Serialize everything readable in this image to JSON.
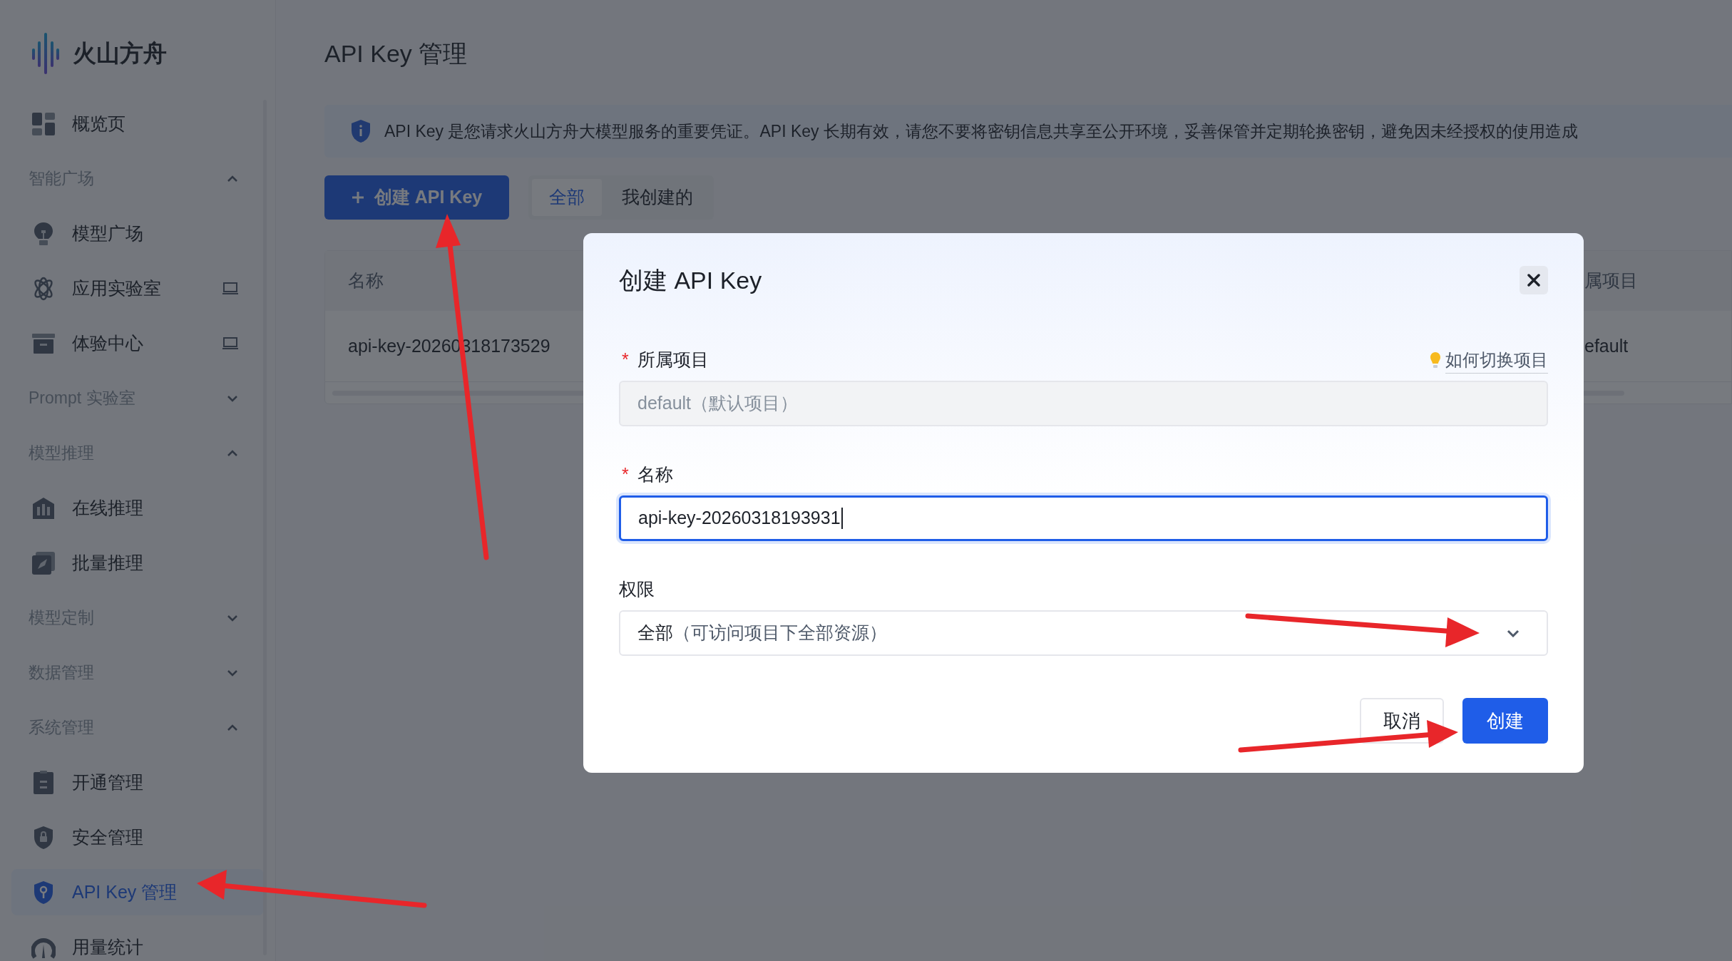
{
  "brand": {
    "name": "火山方舟"
  },
  "sidebar": {
    "items": [
      {
        "kind": "item",
        "label": "概览页",
        "selected": false,
        "trailing_icon": false
      },
      {
        "kind": "group",
        "label": "智能广场",
        "expanded": true
      },
      {
        "kind": "item",
        "label": "模型广场",
        "selected": false,
        "trailing_icon": false
      },
      {
        "kind": "item",
        "label": "应用实验室",
        "selected": false,
        "trailing_icon": true
      },
      {
        "kind": "item",
        "label": "体验中心",
        "selected": false,
        "trailing_icon": true
      },
      {
        "kind": "group",
        "label": "Prompt 实验室",
        "expanded": false
      },
      {
        "kind": "group",
        "label": "模型推理",
        "expanded": true
      },
      {
        "kind": "item",
        "label": "在线推理",
        "selected": false,
        "trailing_icon": false
      },
      {
        "kind": "item",
        "label": "批量推理",
        "selected": false,
        "trailing_icon": false
      },
      {
        "kind": "group",
        "label": "模型定制",
        "expanded": false
      },
      {
        "kind": "group",
        "label": "数据管理",
        "expanded": false
      },
      {
        "kind": "group",
        "label": "系统管理",
        "expanded": true
      },
      {
        "kind": "item",
        "label": "开通管理",
        "selected": false,
        "trailing_icon": false
      },
      {
        "kind": "item",
        "label": "安全管理",
        "selected": false,
        "trailing_icon": false
      },
      {
        "kind": "item",
        "label": "API Key 管理",
        "selected": true,
        "trailing_icon": false
      },
      {
        "kind": "item",
        "label": "用量统计",
        "selected": false,
        "trailing_icon": false
      }
    ]
  },
  "page": {
    "title": "API Key 管理",
    "notice": "API Key 是您请求火山方舟大模型服务的重要凭证。API Key 长期有效，请您不要将密钥信息共享至公开环境，妥善保管并定期轮换密钥，避免因未经授权的使用造成",
    "create_button": "创建 API Key",
    "tabs": [
      {
        "label": "全部",
        "selected": true
      },
      {
        "label": "我创建的",
        "selected": false
      }
    ],
    "table": {
      "columns": [
        "名称",
        "属项目"
      ],
      "rows": [
        [
          "api-key-20260318173529",
          "efault"
        ]
      ]
    }
  },
  "dialog": {
    "title": "创建 API Key",
    "fields": [
      {
        "kind": "readonly",
        "label": "所属项目",
        "required_mark": "*",
        "help_link": "如何切换项目",
        "value": "default（默认项目）"
      },
      {
        "kind": "text",
        "label": "名称",
        "required_mark": "*",
        "value": "api-key-20260318193931",
        "focused": true
      },
      {
        "kind": "select",
        "label": "权限",
        "value": "全部",
        "note": "（可访问项目下全部资源）"
      }
    ],
    "buttons": [
      {
        "kind": "secondary",
        "label": "取消"
      },
      {
        "kind": "primary",
        "label": "创建"
      }
    ]
  }
}
